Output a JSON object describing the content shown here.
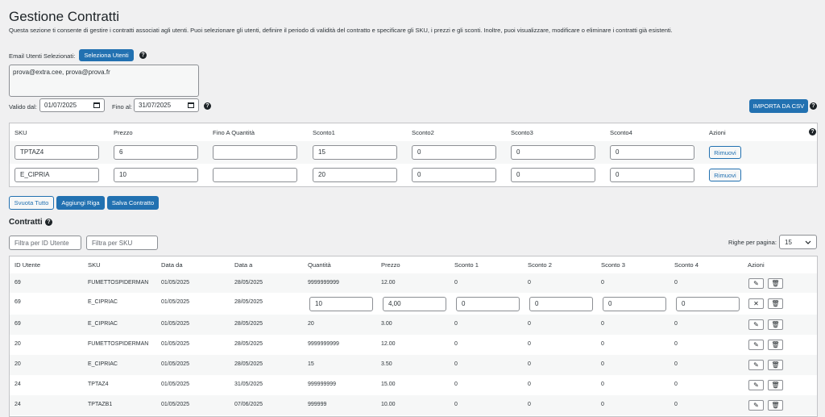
{
  "page": {
    "title": "Gestione Contratti",
    "description": "Questa sezione ti consente di gestire i contratti associati agli utenti. Puoi selezionare gli utenti, definire il periodo di validità del contratto e specificare gli SKU, i prezzi e gli sconti. Inoltre, puoi visualizzare, modificare o eliminare i contratti già esistenti."
  },
  "users": {
    "label": "Email Utenti Selezionati:",
    "select_button": "Seleziona Utenti",
    "emails": "prova@extra.cee, prova@prova.fr"
  },
  "validity": {
    "from_label": "Valido dal:",
    "from_value": "01/07/2025",
    "to_label": "Fino al:",
    "to_value": "31/07/2025"
  },
  "import_button": "IMPORTA DA CSV",
  "editor": {
    "headers": [
      "SKU",
      "Prezzo",
      "Fino A Quantità",
      "Sconto1",
      "Sconto2",
      "Sconto3",
      "Sconto4",
      "Azioni"
    ],
    "rows": [
      {
        "sku": "TPTAZ4",
        "prezzo": "6",
        "fino": "",
        "s1": "15",
        "s2": "0",
        "s3": "0",
        "s4": "0",
        "action": "Rimuovi"
      },
      {
        "sku": "E_CIPRIA",
        "prezzo": "10",
        "fino": "",
        "s1": "20",
        "s2": "0",
        "s3": "0",
        "s4": "0",
        "action": "Rimuovi"
      }
    ]
  },
  "buttons": {
    "clear": "Svuota Tutto",
    "add_row": "Aggiungi Riga",
    "save": "Salva Contratto"
  },
  "contracts": {
    "title": "Contratti",
    "filter_user_placeholder": "Filtra per ID Utente",
    "filter_sku_placeholder": "Filtra per SKU",
    "rows_per_page_label": "Righe per pagina:",
    "rows_per_page_value": "15",
    "headers": [
      "ID Utente",
      "SKU",
      "Data da",
      "Data a",
      "Quantità",
      "Prezzo",
      "Sconto 1",
      "Sconto 2",
      "Sconto 3",
      "Sconto 4",
      "Azioni"
    ],
    "rows": [
      {
        "id": "69",
        "sku": "FUMETTOSPIDERMAN",
        "da": "01/05/2025",
        "a": "28/05/2025",
        "qta": "9999999999",
        "prezzo": "12.00",
        "s1": "0",
        "s2": "0",
        "s3": "0",
        "s4": "0"
      },
      {
        "id": "69",
        "sku": "E_CIPRIAC",
        "da": "01/05/2025",
        "a": "28/05/2025",
        "qta": "10",
        "prezzo": "4,00",
        "s1": "0",
        "s2": "0",
        "s3": "0",
        "s4": "0"
      },
      {
        "id": "69",
        "sku": "E_CIPRIAC",
        "da": "01/05/2025",
        "a": "28/05/2025",
        "qta": "20",
        "prezzo": "3.00",
        "s1": "0",
        "s2": "0",
        "s3": "0",
        "s4": "0"
      },
      {
        "id": "20",
        "sku": "FUMETTOSPIDERMAN",
        "da": "01/05/2025",
        "a": "28/05/2025",
        "qta": "9999999999",
        "prezzo": "12.00",
        "s1": "0",
        "s2": "0",
        "s3": "0",
        "s4": "0"
      },
      {
        "id": "20",
        "sku": "E_CIPRIAC",
        "da": "01/05/2025",
        "a": "28/05/2025",
        "qta": "15",
        "prezzo": "3.50",
        "s1": "0",
        "s2": "0",
        "s3": "0",
        "s4": "0"
      },
      {
        "id": "24",
        "sku": "TPTAZ4",
        "da": "01/05/2025",
        "a": "31/05/2025",
        "qta": "999999999",
        "prezzo": "15.00",
        "s1": "0",
        "s2": "0",
        "s3": "0",
        "s4": "0"
      },
      {
        "id": "24",
        "sku": "TPTAZB1",
        "da": "01/05/2025",
        "a": "07/06/2025",
        "qta": "999999",
        "prezzo": "10.00",
        "s1": "0",
        "s2": "0",
        "s3": "0",
        "s4": "0"
      }
    ]
  }
}
